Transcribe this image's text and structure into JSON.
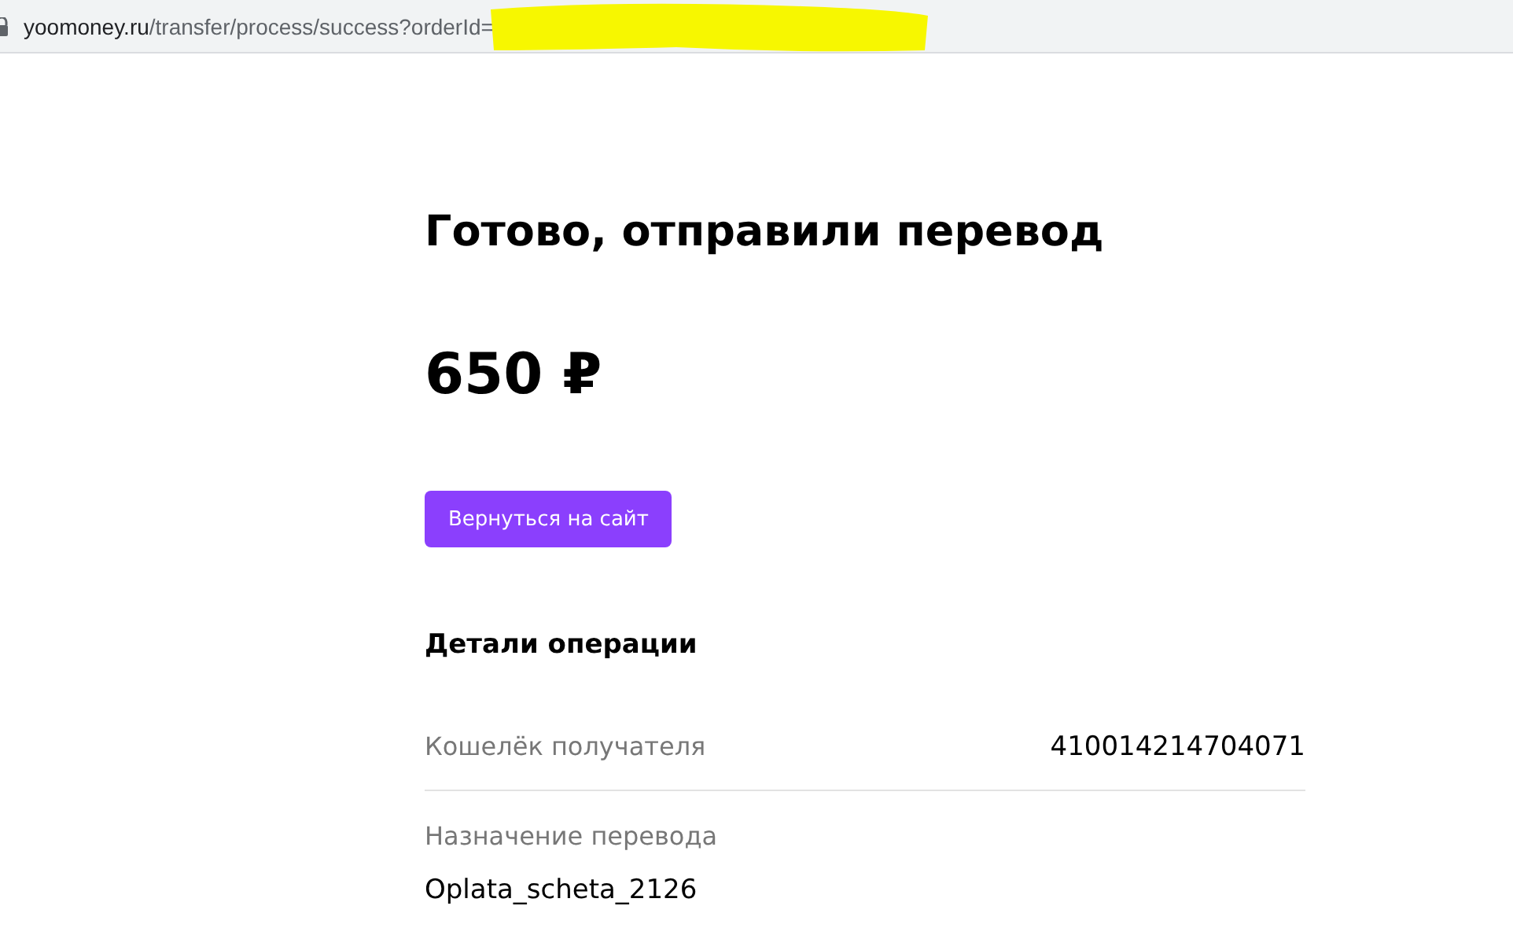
{
  "address_bar": {
    "host": "yoomoney.ru",
    "path": "/transfer/process/success?orderId=",
    "redacted": true
  },
  "title": "Готово, отправили перевод",
  "amount": "650 ₽",
  "return_button": "Вернуться на сайт",
  "details": {
    "heading": "Детали операции",
    "rows": [
      {
        "kind": "inline",
        "label": "Кошелёк получателя",
        "value": "410014214704071"
      },
      {
        "kind": "stacked",
        "label": "Назначение перевода",
        "value": "Oplata_scheta_2126"
      }
    ]
  }
}
